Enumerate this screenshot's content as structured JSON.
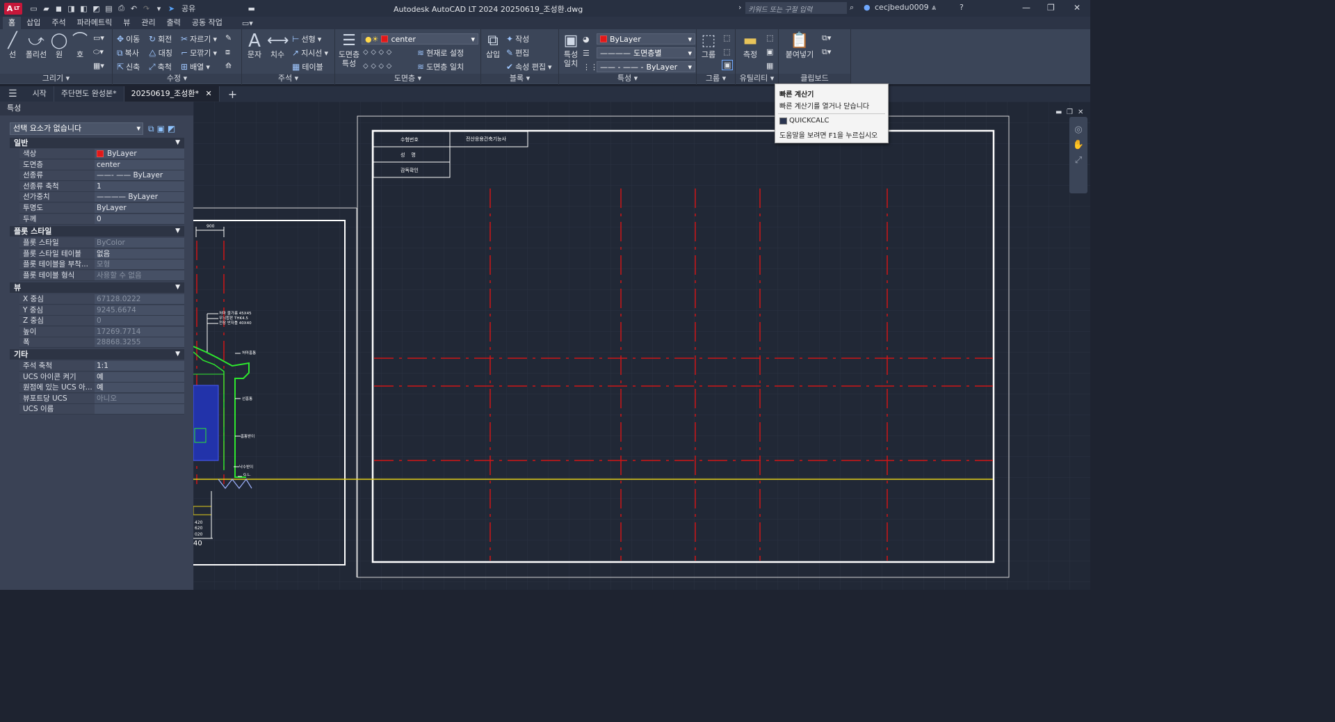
{
  "titlebar": {
    "app_badge": "A",
    "lt_badge": "LT",
    "share": "공유",
    "title": "Autodesk AutoCAD LT 2024   20250619_조성환.dwg",
    "search_placeholder": "키워드 또는 구절 입력",
    "user": "cecjbedu0009"
  },
  "tabs": [
    "홈",
    "삽입",
    "주석",
    "파라메트릭",
    "뷰",
    "관리",
    "출력",
    "공동 작업"
  ],
  "ribbon": {
    "draw": {
      "title": "그리기",
      "line": "선",
      "polyline": "폴리선",
      "circle": "원",
      "arc": "호"
    },
    "modify": {
      "title": "수정",
      "move": "이동",
      "rotate": "회전",
      "trim": "자르기",
      "copy": "복사",
      "mirror": "대칭",
      "fillet": "모깎기",
      "stretch": "신축",
      "scale": "축척",
      "array": "배열"
    },
    "annotation": {
      "title": "주석",
      "text": "문자",
      "dim": "치수",
      "linear": "선형",
      "leader": "지시선",
      "table": "테이블"
    },
    "layers": {
      "title": "도면층",
      "props": "도면층 특성",
      "current_layer": "center",
      "make_current": "현재로 설정",
      "match": "도면층 일치"
    },
    "block": {
      "title": "블록",
      "insert": "삽입",
      "create": "작성",
      "edit": "편집",
      "attedit": "속성 편집"
    },
    "properties": {
      "title": "특성",
      "match": "특성 일치",
      "color": "ByLayer",
      "lineweight": "도면층별",
      "linetype": "ByLayer"
    },
    "groups": {
      "title": "그룹",
      "group": "그룹"
    },
    "utilities": {
      "title": "유틸리티",
      "measure": "측정"
    },
    "clipboard": {
      "title": "클립보드",
      "paste": "붙여넣기"
    }
  },
  "doctabs": [
    "시작",
    "주단면도 완성본*",
    "20250619_조성환*"
  ],
  "props": {
    "title": "특성",
    "selection": "선택 요소가 없습니다",
    "general": {
      "title": "일반",
      "rows": [
        [
          "색상",
          "ByLayer"
        ],
        [
          "도면층",
          "center"
        ],
        [
          "선종류",
          "——- ——  ByLayer"
        ],
        [
          "선종류 축척",
          "1"
        ],
        [
          "선가중치",
          "————  ByLayer"
        ],
        [
          "투명도",
          "ByLayer"
        ],
        [
          "두께",
          "0"
        ]
      ]
    },
    "plot": {
      "title": "플롯 스타일",
      "rows": [
        [
          "플롯 스타일",
          "ByColor"
        ],
        [
          "플롯 스타일 테이블",
          "없음"
        ],
        [
          "플롯 테이블을 부착...",
          "모형"
        ],
        [
          "플롯 테이블 형식",
          "사용할 수 없음"
        ]
      ]
    },
    "view": {
      "title": "뷰",
      "rows": [
        [
          "X 중심",
          "67128.0222"
        ],
        [
          "Y 중심",
          "9245.6674"
        ],
        [
          "Z 중심",
          "0"
        ],
        [
          "높이",
          "17269.7714"
        ],
        [
          "폭",
          "28868.3255"
        ]
      ]
    },
    "misc": {
      "title": "기타",
      "rows": [
        [
          "주석 축척",
          "1:1"
        ],
        [
          "UCS 아이콘 켜기",
          "예"
        ],
        [
          "원점에 있는 UCS 아...",
          "예"
        ],
        [
          "뷰포트당 UCS",
          "아니오"
        ],
        [
          "UCS 이름",
          ""
        ]
      ]
    }
  },
  "drawing": {
    "table": [
      "수험번호",
      "전산응용건축기능사",
      "성    명",
      "감독확인"
    ],
    "dim": "900",
    "labels": [
      "처마 물가름 45X45",
      "무늬합판 THK4.5",
      "천장 반자틀 40X40",
      "처마홈통",
      "선홈통",
      "홈통받이",
      "낙수받이",
      "G.L."
    ],
    "bottom_dims": [
      "420",
      "620",
      "020"
    ],
    "bottom_text": "40"
  },
  "tooltip": {
    "title": "빠른 계산기",
    "desc": "빠른 계산기를 열거나 닫습니다",
    "cmd": "QUICKCALC",
    "help": "도움말을 보려면 F1을 누르십시오"
  }
}
